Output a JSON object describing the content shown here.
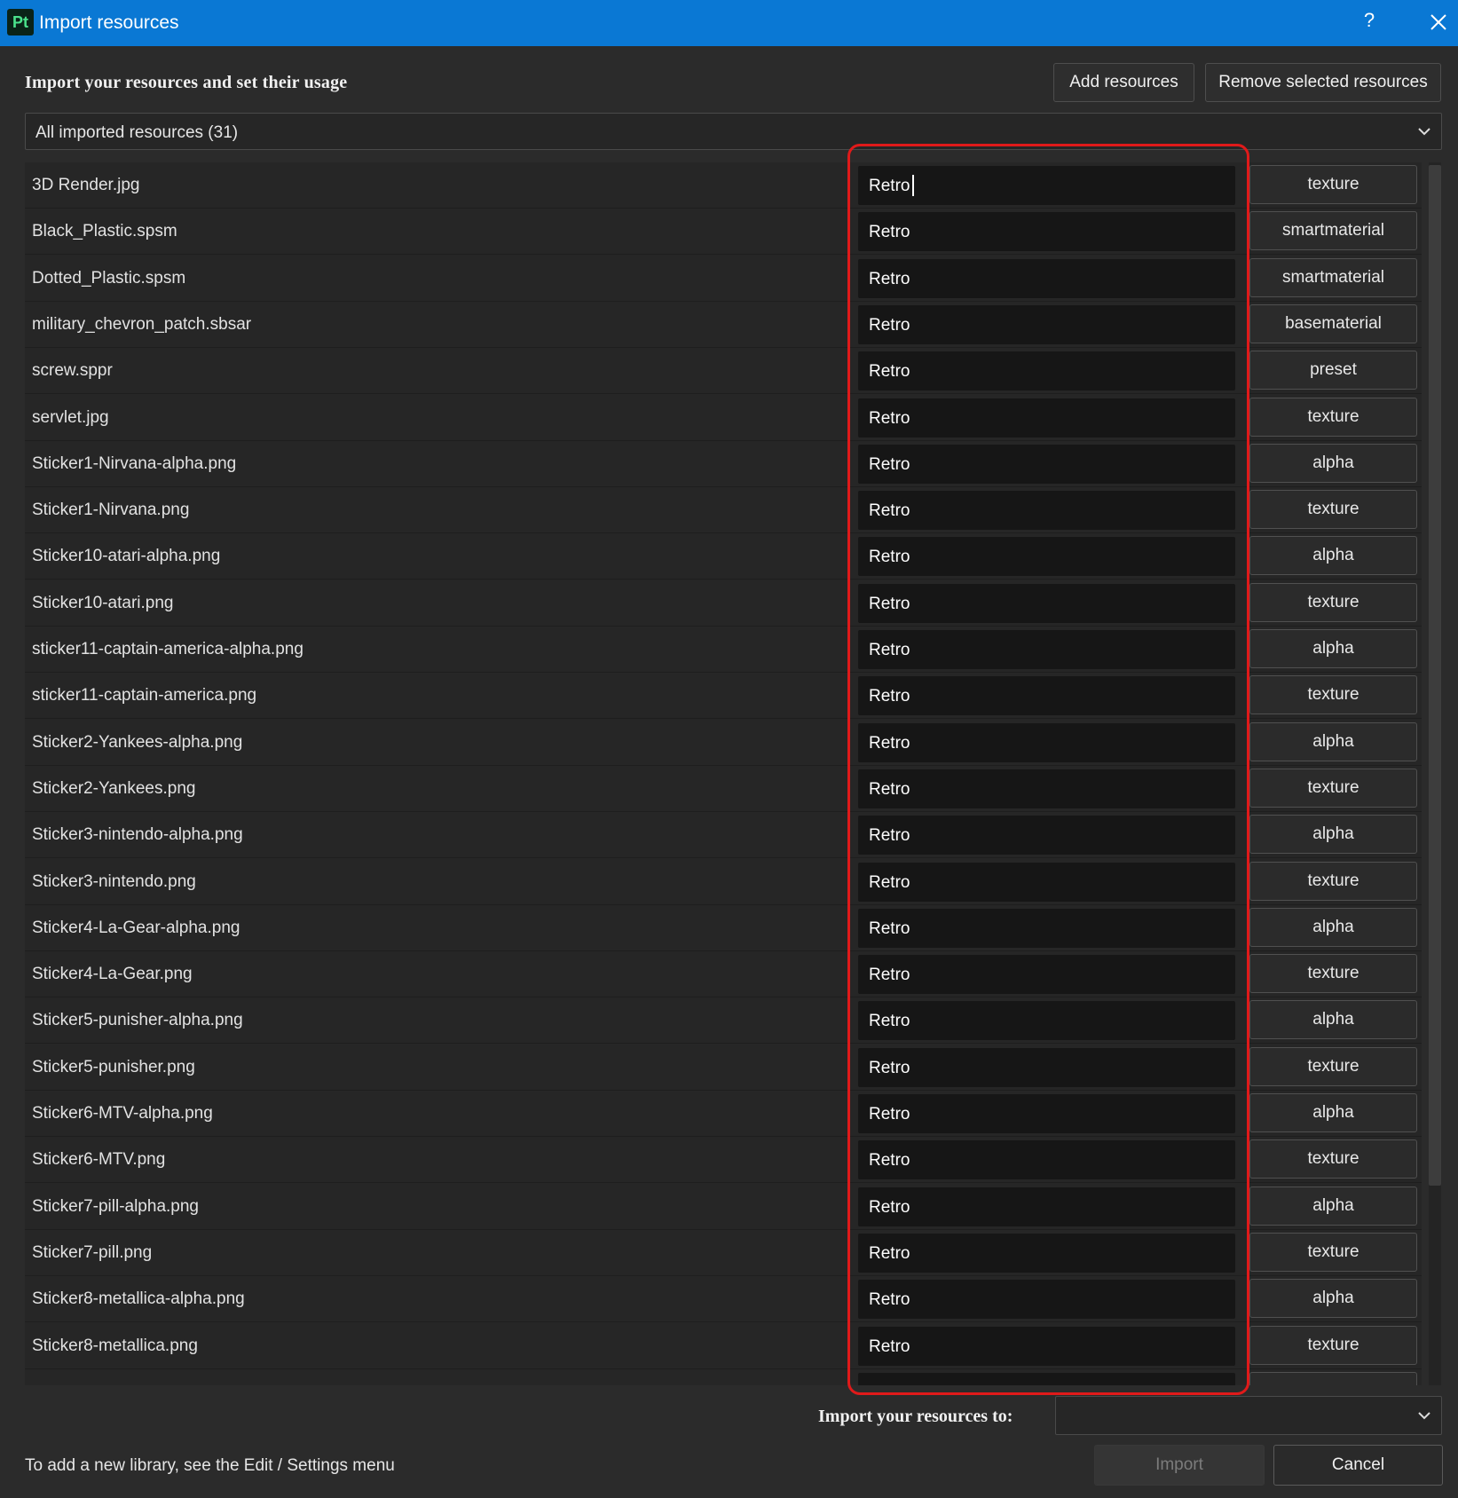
{
  "window": {
    "logo": "Pt",
    "title": "Import resources",
    "help": "?"
  },
  "header": {
    "heading": "Import your resources and set their usage",
    "add_label": "Add resources",
    "remove_label": "Remove selected resources"
  },
  "filter": {
    "selected": "All imported resources (31)"
  },
  "resources": [
    {
      "name": "3D Render.jpg",
      "tag": "Retro",
      "type": "texture"
    },
    {
      "name": "Black_Plastic.spsm",
      "tag": "Retro",
      "type": "smartmaterial"
    },
    {
      "name": "Dotted_Plastic.spsm",
      "tag": "Retro",
      "type": "smartmaterial"
    },
    {
      "name": "military_chevron_patch.sbsar",
      "tag": "Retro",
      "type": "basematerial"
    },
    {
      "name": "screw.sppr",
      "tag": "Retro",
      "type": "preset"
    },
    {
      "name": "servlet.jpg",
      "tag": "Retro",
      "type": "texture"
    },
    {
      "name": "Sticker1-Nirvana-alpha.png",
      "tag": "Retro",
      "type": "alpha"
    },
    {
      "name": "Sticker1-Nirvana.png",
      "tag": "Retro",
      "type": "texture"
    },
    {
      "name": "Sticker10-atari-alpha.png",
      "tag": "Retro",
      "type": "alpha"
    },
    {
      "name": "Sticker10-atari.png",
      "tag": "Retro",
      "type": "texture"
    },
    {
      "name": "sticker11-captain-america-alpha.png",
      "tag": "Retro",
      "type": "alpha"
    },
    {
      "name": "sticker11-captain-america.png",
      "tag": "Retro",
      "type": "texture"
    },
    {
      "name": "Sticker2-Yankees-alpha.png",
      "tag": "Retro",
      "type": "alpha"
    },
    {
      "name": "Sticker2-Yankees.png",
      "tag": "Retro",
      "type": "texture"
    },
    {
      "name": "Sticker3-nintendo-alpha.png",
      "tag": "Retro",
      "type": "alpha"
    },
    {
      "name": "Sticker3-nintendo.png",
      "tag": "Retro",
      "type": "texture"
    },
    {
      "name": "Sticker4-La-Gear-alpha.png",
      "tag": "Retro",
      "type": "alpha"
    },
    {
      "name": "Sticker4-La-Gear.png",
      "tag": "Retro",
      "type": "texture"
    },
    {
      "name": "Sticker5-punisher-alpha.png",
      "tag": "Retro",
      "type": "alpha"
    },
    {
      "name": "Sticker5-punisher.png",
      "tag": "Retro",
      "type": "texture"
    },
    {
      "name": "Sticker6-MTV-alpha.png",
      "tag": "Retro",
      "type": "alpha"
    },
    {
      "name": "Sticker6-MTV.png",
      "tag": "Retro",
      "type": "texture"
    },
    {
      "name": "Sticker7-pill-alpha.png",
      "tag": "Retro",
      "type": "alpha"
    },
    {
      "name": "Sticker7-pill.png",
      "tag": "Retro",
      "type": "texture"
    },
    {
      "name": "Sticker8-metallica-alpha.png",
      "tag": "Retro",
      "type": "alpha"
    },
    {
      "name": "Sticker8-metallica.png",
      "tag": "Retro",
      "type": "texture"
    },
    {
      "name": "",
      "tag": "",
      "type": ""
    }
  ],
  "footer": {
    "destination_label": "Import your resources to:",
    "destination_value": "",
    "hint": "To add a new library, see the Edit / Settings menu",
    "import_label": "Import",
    "cancel_label": "Cancel"
  },
  "colors": {
    "titlebar": "#0a78d4",
    "background": "#2b2b2b",
    "highlight_outline": "#e01a1a",
    "disabled_text": "#7c7c7c"
  }
}
